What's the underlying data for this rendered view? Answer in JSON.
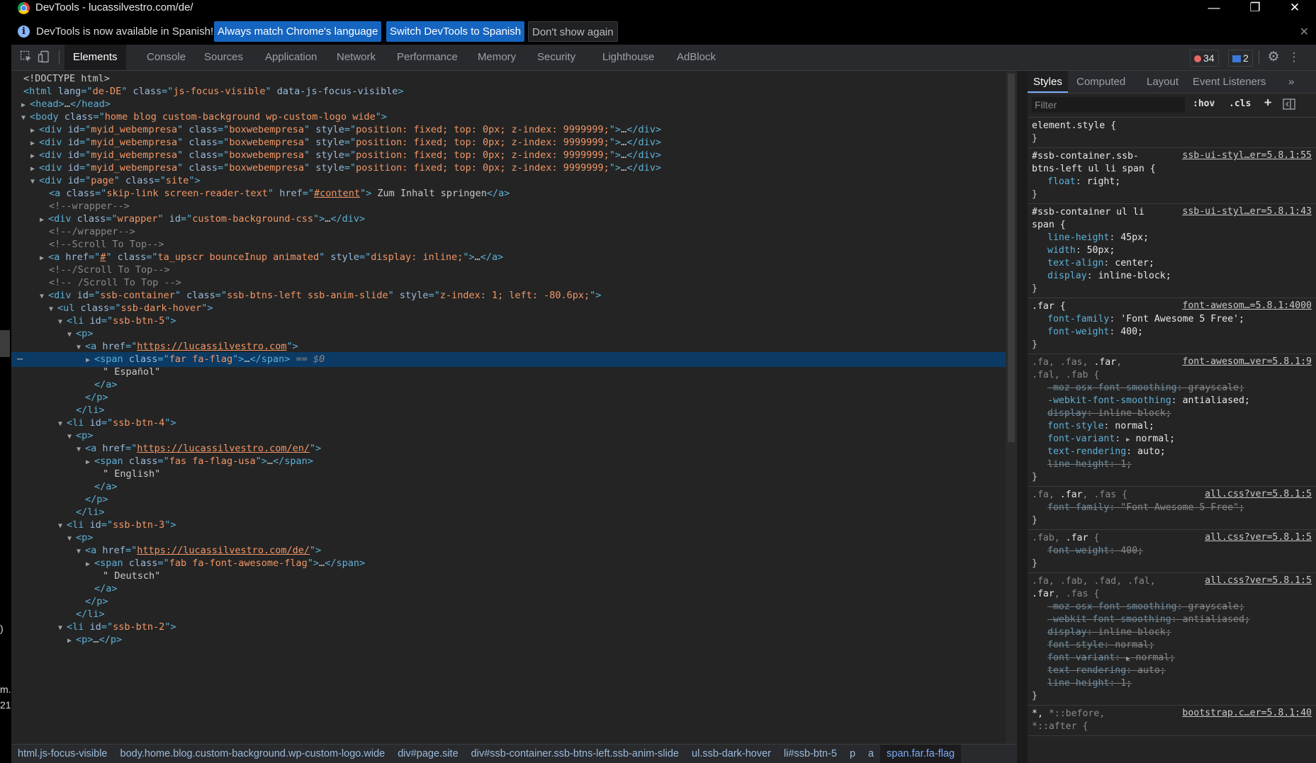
{
  "window": {
    "title": "DevTools - lucassilvestro.com/de/",
    "minimize": "—",
    "restore": "❐",
    "close": "✕"
  },
  "infobar": {
    "icon": "i",
    "message": "DevTools is now available in Spanish!",
    "btn_match": "Always match Chrome's language",
    "btn_switch": "Switch DevTools to Spanish",
    "btn_dont": "Don't show again",
    "close": "✕"
  },
  "toolbar": {
    "tabs": [
      "Elements",
      "Console",
      "Sources",
      "Application",
      "Network",
      "Performance",
      "Memory",
      "Security",
      "Lighthouse",
      "AdBlock"
    ],
    "active_tab": "Elements",
    "error_count": "34",
    "message_count": "2"
  },
  "left_fragments": [
    "m.",
    "21",
    ")"
  ],
  "dom": {
    "doctype": "<!DOCTYPE html>",
    "html_tag": "html",
    "html_lang_attr": "lang",
    "html_lang_val": "de-DE",
    "html_class_attr": "class",
    "html_class_val": "js-focus-visible",
    "html_data_attr": "data-js-focus-visible",
    "head": "head",
    "body_tag": "body",
    "body_class": "home blog custom-background wp-custom-logo wide",
    "div_tag": "div",
    "id_attr": "id",
    "class_attr": "class",
    "style_attr": "style",
    "href_attr": "href",
    "webempresa_id": "myid_webempresa",
    "webempresa_class": "boxwebempresa",
    "webempresa_style": "position: fixed; top: 0px; z-index: 9999999;",
    "page_id": "page",
    "page_class": "site",
    "a_tag": "a",
    "skip_class": "skip-link screen-reader-text",
    "skip_href": "#content",
    "skip_text": " Zum Inhalt springen",
    "c_wrapper": "<!--wrapper-->",
    "wrapper_class": "wrapper",
    "wrapper_id": "custom-background-css",
    "c_wrapper_end": "<!--/wrapper-->",
    "c_scroll": "<!--Scroll To Top-->",
    "scroll_href": "#",
    "scroll_class": "ta_upscr bounceInup animated",
    "scroll_style": "display: inline;",
    "c_scroll_end": "<!--/Scroll To Top-->",
    "c_scroll_end2": "<!-- /Scroll To Top -->",
    "ssb_id": "ssb-container",
    "ssb_class": "ssb-btns-left ssb-anim-slide",
    "ssb_style": "z-index: 1; left: -80.6px;",
    "ul_tag": "ul",
    "ul_class": "ssb-dark-hover",
    "li_tag": "li",
    "p_tag": "p",
    "span_tag": "span",
    "li5": "ssb-btn-5",
    "li4": "ssb-btn-4",
    "li3": "ssb-btn-3",
    "li2": "ssb-btn-2",
    "link1": "https://lucassilvestro.com",
    "span1_class": "far fa-flag",
    "sel_marker": " == $0",
    "text1": "\" Español\"",
    "link2": "https://lucassilvestro.com/en/",
    "span2_class": "fas fa-flag-usa",
    "text2": "\" English\"",
    "link3": "https://lucassilvestro.com/de/",
    "span3_class": "fab fa-font-awesome-flag",
    "text3": "\" Deutsch\"",
    "ellipsis_marker": "…"
  },
  "breadcrumbs": [
    "html.js-focus-visible",
    "body.home.blog.custom-background.wp-custom-logo.wide",
    "div#page.site",
    "div#ssb-container.ssb-btns-left.ssb-anim-slide",
    "ul.ssb-dark-hover",
    "li#ssb-btn-5",
    "p",
    "a",
    "span.far.fa-flag"
  ],
  "styles_pane": {
    "tabs": [
      "Styles",
      "Computed",
      "Layout",
      "Event Listeners"
    ],
    "more": "»",
    "filter_placeholder": "Filter",
    "hov": ":hov",
    "cls": ".cls",
    "plus": "+",
    "rules": {
      "r0": {
        "sel": "element.style {",
        "close": "}"
      },
      "r1": {
        "sel1": "#ssb-container.ssb-",
        "sel2": "btns-left ul li span {",
        "src": "ssb-ui-styl…er=5.8.1:55",
        "p1n": "float",
        "p1v": "right;",
        "close": "}"
      },
      "r2": {
        "sel1": "#ssb-container ul li",
        "sel2": "span {",
        "src": "ssb-ui-styl…er=5.8.1:43",
        "p1n": "line-height",
        "p1v": "45px;",
        "p2n": "width",
        "p2v": "50px;",
        "p3n": "text-align",
        "p3v": "center;",
        "p4n": "display",
        "p4v": "inline-block;",
        "close": "}"
      },
      "r3": {
        "sel": ".far {",
        "src": "font-awesom…=5.8.1:4000",
        "p1n": "font-family",
        "p1v": "'Font Awesome 5 Free';",
        "p2n": "font-weight",
        "p2v": "400;",
        "close": "}"
      },
      "r4": {
        "sel1a": ".fa, .fas, ",
        "sel1b": ".far",
        "sel1c": ",",
        "sel2": ".fal, .fab {",
        "src": "font-awesom…ver=5.8.1:9",
        "p1n": "-moz-osx-font-smoothing",
        "p1v": "grayscale;",
        "p2n": "-webkit-font-smoothing",
        "p2v": "antialiased;",
        "p3n": "display",
        "p3v": "inline-block;",
        "p4n": "font-style",
        "p4v": "normal;",
        "p5n": "font-variant",
        "p5v": "normal;",
        "p6n": "text-rendering",
        "p6v": "auto;",
        "p7n": "line-height",
        "p7v": "1;",
        "close": "}"
      },
      "r5": {
        "sel1": ".fa, ",
        "sel2": ".far",
        "sel3": ", .fas {",
        "src": "all.css?ver=5.8.1:5",
        "p1n": "font-family",
        "p1v": "\"Font Awesome 5 Free\";",
        "close": "}"
      },
      "r6": {
        "sel1": ".fab, ",
        "sel2": ".far",
        "sel3": " {",
        "src": "all.css?ver=5.8.1:5",
        "p1n": "font-weight",
        "p1v": "400;",
        "close": "}"
      },
      "r7": {
        "sel1": ".fa, .fab, .fad, .fal,",
        "sel2a": ".far",
        "sel2b": ", .fas {",
        "src": "all.css?ver=5.8.1:5",
        "p1n": "-moz-osx-font-smoothing",
        "p1v": "grayscale;",
        "p2n": "-webkit-font-smoothing",
        "p2v": "antialiased;",
        "p3n": "display",
        "p3v": "inline-block;",
        "p4n": "font-style",
        "p4v": "normal;",
        "p5n": "font-variant",
        "p5v": "normal;",
        "p6n": "text-rendering",
        "p6v": "auto;",
        "p7n": "line-height",
        "p7v": "1;",
        "close": "}"
      },
      "r8": {
        "sel1": "*, ",
        "sel2": "*::before,",
        "sel3": "*::after {",
        "src": "bootstrap.c…er=5.8.1:40"
      }
    }
  },
  "colors": {
    "accent": "#1565c0",
    "selection": "#0b3a64",
    "tag": "#5db0d7",
    "attr_value": "#f29766"
  }
}
